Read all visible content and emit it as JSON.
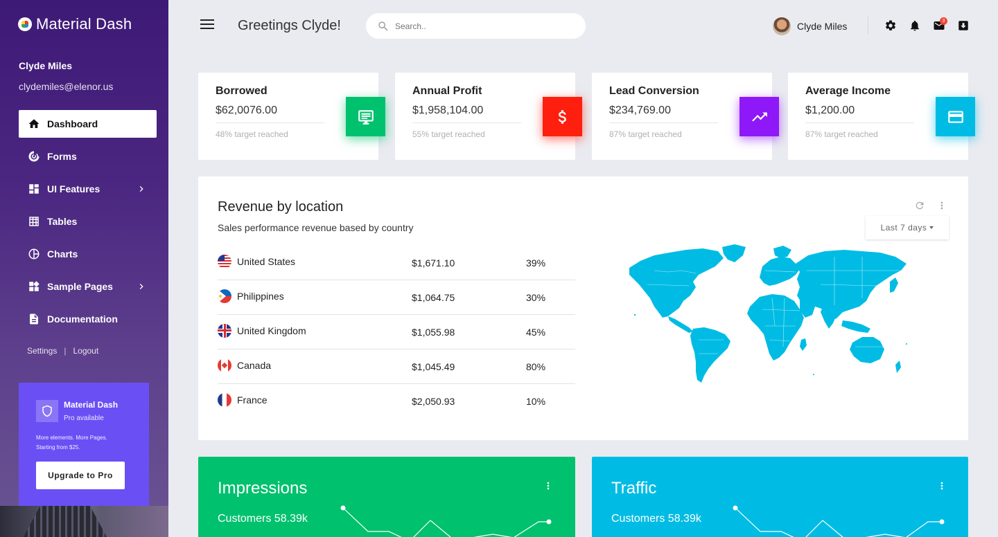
{
  "app": {
    "name": "Material Dash"
  },
  "sidebar": {
    "user_name": "Clyde Miles",
    "user_email": "clydemiles@elenor.us",
    "items": [
      {
        "label": "Dashboard",
        "icon": "home-icon",
        "active": true
      },
      {
        "label": "Forms",
        "icon": "track-changes-icon"
      },
      {
        "label": "UI Features",
        "icon": "dashboard-icon",
        "has_submenu": true
      },
      {
        "label": "Tables",
        "icon": "grid-icon"
      },
      {
        "label": "Charts",
        "icon": "pie-chart-icon"
      },
      {
        "label": "Sample Pages",
        "icon": "widgets-icon",
        "has_submenu": true
      },
      {
        "label": "Documentation",
        "icon": "description-icon"
      }
    ],
    "settings_label": "Settings",
    "logout_label": "Logout",
    "separator": "|",
    "pro": {
      "title": "Material Dash",
      "subtitle": "Pro available",
      "description_line1": "More elements. More Pages.",
      "description_line2": "Starting from $25.",
      "button_label": "Upgrade to Pro"
    }
  },
  "topbar": {
    "greeting": "Greetings Clyde!",
    "search_placeholder": "Search..",
    "user_name": "Clyde Miles",
    "mail_badge": "3"
  },
  "stats": [
    {
      "title": "Borrowed",
      "value": "$62,0076.00",
      "note": "48% target reached",
      "icon": "desktop-message-icon",
      "color": "#00c16e"
    },
    {
      "title": "Annual Profit",
      "value": "$1,958,104.00",
      "note": "55% target reached",
      "icon": "dollar-icon",
      "color": "#ff1f0e"
    },
    {
      "title": "Lead Conversion",
      "value": "$234,769.00",
      "note": "87% target reached",
      "icon": "trending-up-icon",
      "color": "#8e18f7"
    },
    {
      "title": "Average Income",
      "value": "$1,200.00",
      "note": "87% target reached",
      "icon": "credit-card-icon",
      "color": "#00bce4"
    }
  ],
  "revenue": {
    "title": "Revenue by location",
    "subtitle": "Sales performance revenue based by country",
    "range_label": "Last 7 days",
    "rows": [
      {
        "country": "United States",
        "amount": "$1,671.10",
        "percent": "39%"
      },
      {
        "country": "Philippines",
        "amount": "$1,064.75",
        "percent": "30%"
      },
      {
        "country": "United Kingdom",
        "amount": "$1,055.98",
        "percent": "45%"
      },
      {
        "country": "Canada",
        "amount": "$1,045.49",
        "percent": "80%"
      },
      {
        "country": "France",
        "amount": "$2,050.93",
        "percent": "10%"
      }
    ],
    "map_color": "#00bce4"
  },
  "bottom_cards": [
    {
      "title": "Impressions",
      "subtitle": "Customers 58.39k",
      "color": "#00c16e"
    },
    {
      "title": "Traffic",
      "subtitle": "Customers 58.39k",
      "color": "#00bce4"
    }
  ]
}
